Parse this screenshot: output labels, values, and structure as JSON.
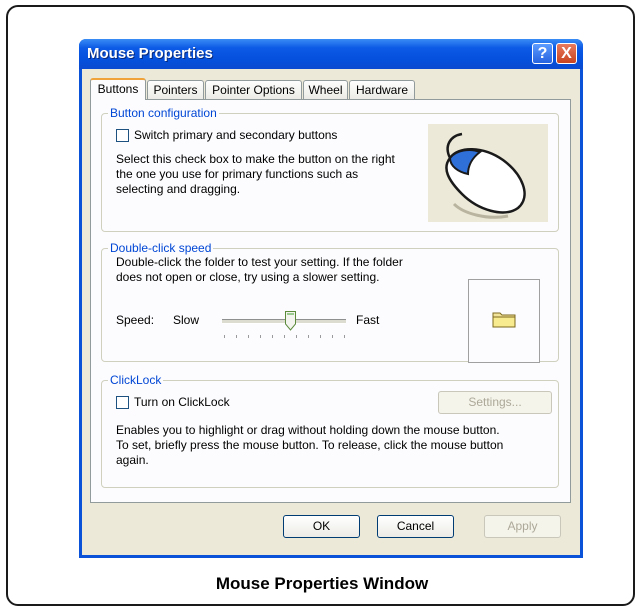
{
  "window": {
    "title": "Mouse Properties",
    "help_glyph": "?",
    "close_glyph": "X"
  },
  "tabs": [
    "Buttons",
    "Pointers",
    "Pointer Options",
    "Wheel",
    "Hardware"
  ],
  "button_config": {
    "group_label": "Button configuration",
    "checkbox_label": "Switch primary and secondary buttons",
    "description": [
      "Select this check box to make the button on the right",
      "the one you use for primary functions such as",
      "selecting and dragging."
    ]
  },
  "double_click": {
    "group_label": "Double-click speed",
    "description": [
      "Double-click the folder to test your setting. If the folder",
      "does not open or close, try using a slower setting."
    ],
    "speed_label": "Speed:",
    "slow_label": "Slow",
    "fast_label": "Fast",
    "slider_fraction": 0.55
  },
  "clicklock": {
    "group_label": "ClickLock",
    "checkbox_label": "Turn on ClickLock",
    "settings_label": "Settings...",
    "description": [
      "Enables you to highlight or drag without holding down the mouse button.",
      "To set, briefly press the mouse button. To release, click the mouse button",
      "again."
    ]
  },
  "footer": {
    "ok_label": "OK",
    "cancel_label": "Cancel",
    "apply_label": "Apply"
  },
  "caption": "Mouse Properties Window"
}
